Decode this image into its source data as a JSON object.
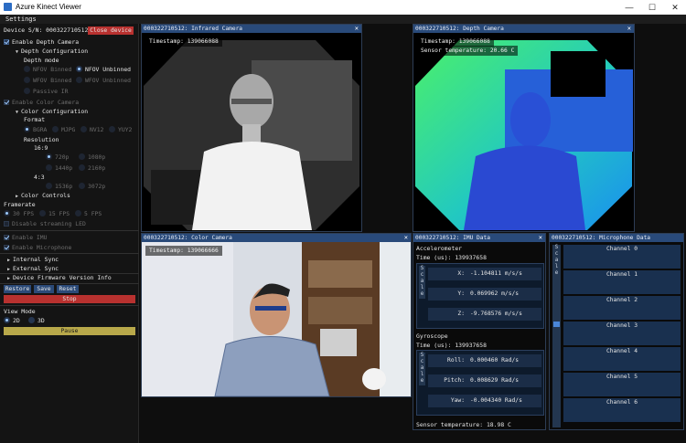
{
  "window": {
    "title": "Azure Kinect Viewer",
    "minimize": "—",
    "maximize": "☐",
    "close": "✕"
  },
  "menu": {
    "settings": "Settings"
  },
  "sidebar": {
    "device_label": "Device S/N: 000322710512",
    "close_device": "Close device",
    "enable_depth": "Enable Depth Camera",
    "depth_config": "Depth Configuration",
    "depth_mode": "Depth mode",
    "depth_modes": [
      "NFOV Binned",
      "NFOV Unbinned",
      "WFOV Binned",
      "WFOV Unbinned",
      "Passive IR"
    ],
    "enable_color": "Enable Color Camera",
    "color_config": "Color Configuration",
    "format": "Format",
    "formats": [
      "BGRA",
      "MJPG",
      "NV12",
      "YUY2"
    ],
    "resolution": "Resolution",
    "ratio_169": "16:9",
    "res_169": [
      "720p",
      "1080p",
      "1440p",
      "2160p"
    ],
    "ratio_43": "4:3",
    "res_43": [
      "1536p",
      "3072p"
    ],
    "color_controls": "Color Controls",
    "framerate": "Framerate",
    "fps": [
      "30 FPS",
      "15 FPS",
      "5 FPS"
    ],
    "disable_led": "Disable streaming LED",
    "enable_imu": "Enable IMU",
    "enable_mic": "Enable Microphone",
    "internal_sync": "Internal Sync",
    "external_sync": "External Sync",
    "firmware": "Device Firmware Version Info",
    "restore": "Restore",
    "save": "Save",
    "reset": "Reset",
    "stop": "Stop",
    "view_mode": "View Mode",
    "view_2d": "2D",
    "view_3d": "3D",
    "pause": "Pause"
  },
  "panels": {
    "infrared": {
      "title": "000322710512: Infrared Camera",
      "timestamp": "Timestamp: 139066088"
    },
    "depth": {
      "title": "000322710512: Depth Camera",
      "timestamp": "Timestamp: 139066088",
      "temperature": "Sensor temperature: 20.66 C"
    },
    "color": {
      "title": "000322710512: Color Camera",
      "timestamp": "Timestamp: 139066666"
    },
    "imu": {
      "title": "000322710512: IMU Data",
      "accelerometer": "Accelerometer",
      "accel_time": "Time (us): 139937658",
      "accel": [
        {
          "axis": "X:",
          "value": "-1.104811 m/s/s"
        },
        {
          "axis": "Y:",
          "value": "0.069962 m/s/s"
        },
        {
          "axis": "Z:",
          "value": "-9.768576 m/s/s"
        }
      ],
      "gyroscope": "Gyroscope",
      "gyro_time": "Time (us): 139937658",
      "gyro": [
        {
          "axis": "Roll:",
          "value": "0.000460 Rad/s"
        },
        {
          "axis": "Pitch:",
          "value": "0.008629 Rad/s"
        },
        {
          "axis": "Yaw:",
          "value": "-0.004340 Rad/s"
        }
      ],
      "scale": "Scale",
      "temperature": "Sensor temperature: 18.98 C"
    },
    "mic": {
      "title": "000322710512: Microphone Data",
      "scale": "Scale",
      "channels": [
        "Channel 0",
        "Channel 1",
        "Channel 2",
        "Channel 3",
        "Channel 4",
        "Channel 5",
        "Channel 6"
      ]
    }
  },
  "colors": {
    "accent": "#294a7a",
    "danger": "#b8312f",
    "pause": "#b8a84a"
  }
}
